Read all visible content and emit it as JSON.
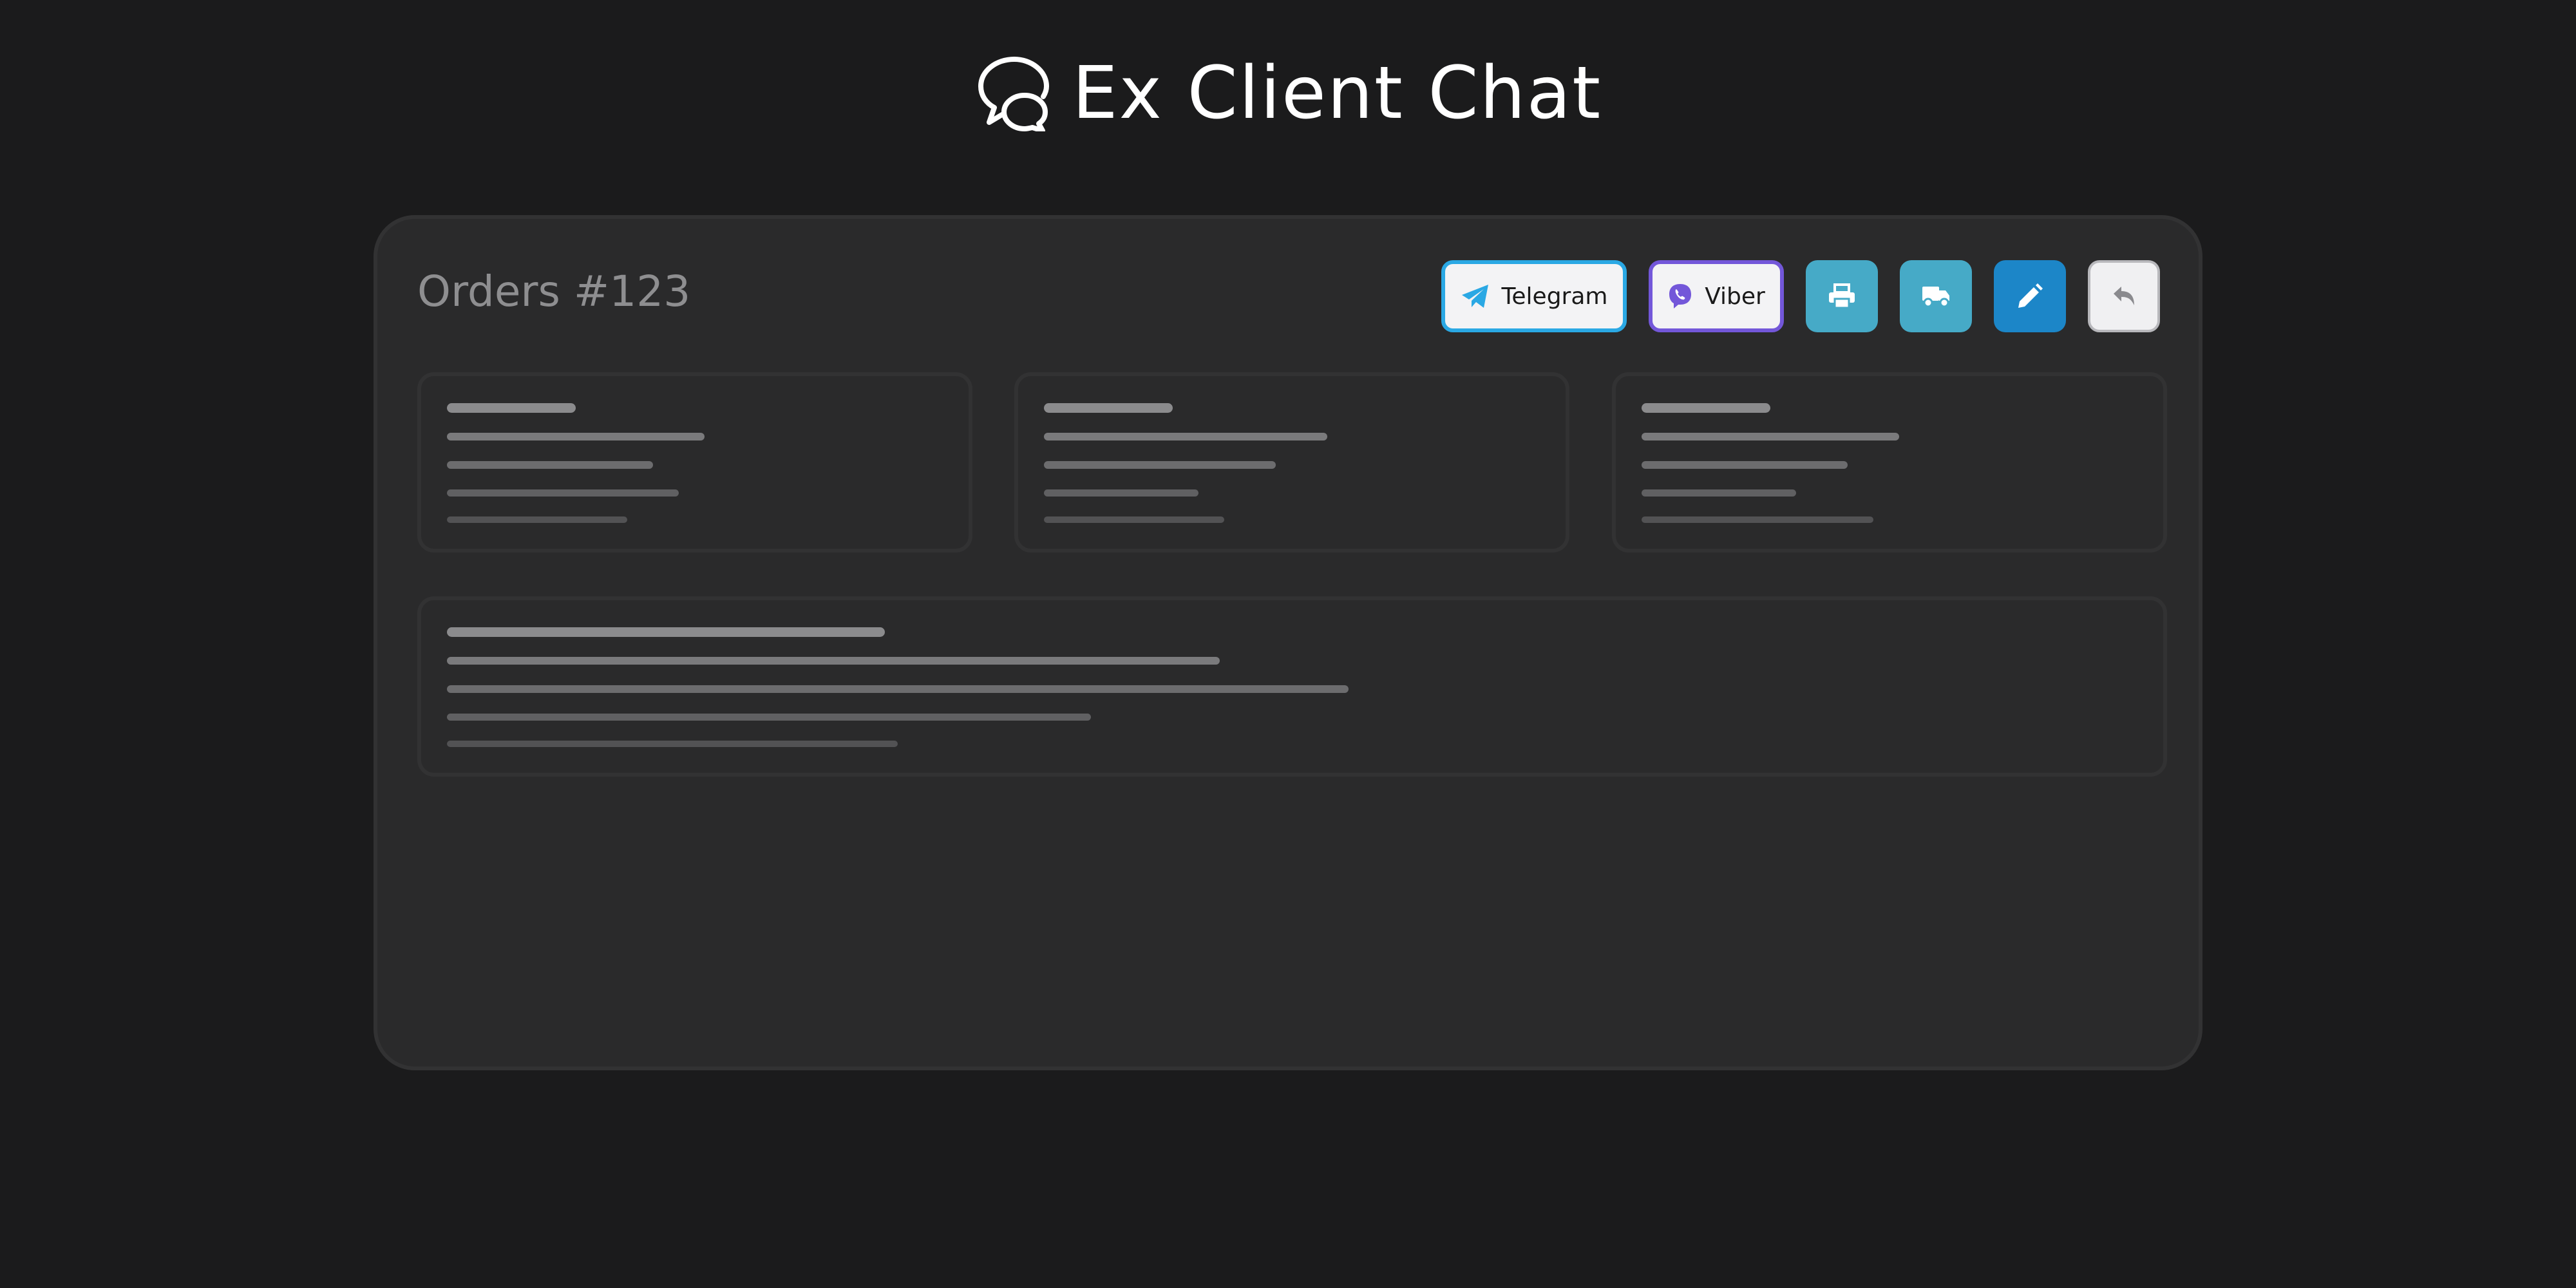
{
  "app": {
    "title": "Ex Client Chat",
    "logo_icon": "chat-bubbles-icon"
  },
  "panel": {
    "title": "Orders #123"
  },
  "toolbar": {
    "telegram_label": "Telegram",
    "viber_label": "Viber",
    "icons": {
      "telegram": "telegram-plane-icon",
      "viber": "viber-icon",
      "print": "printer-icon",
      "delivery": "truck-icon",
      "edit": "pencil-icon",
      "back": "reply-arrow-icon"
    }
  },
  "colors": {
    "background": "#1b1b1c",
    "panel": "#2a2a2b",
    "telegram_accent": "#2aa8e4",
    "viber_accent": "#7357d9",
    "print_button": "#46aac7",
    "delivery_button": "#46aac7",
    "edit_button": "#1c86c8",
    "back_button": "#f0f0f2"
  },
  "cards": {
    "state": "loading-skeleton",
    "count": 4
  }
}
